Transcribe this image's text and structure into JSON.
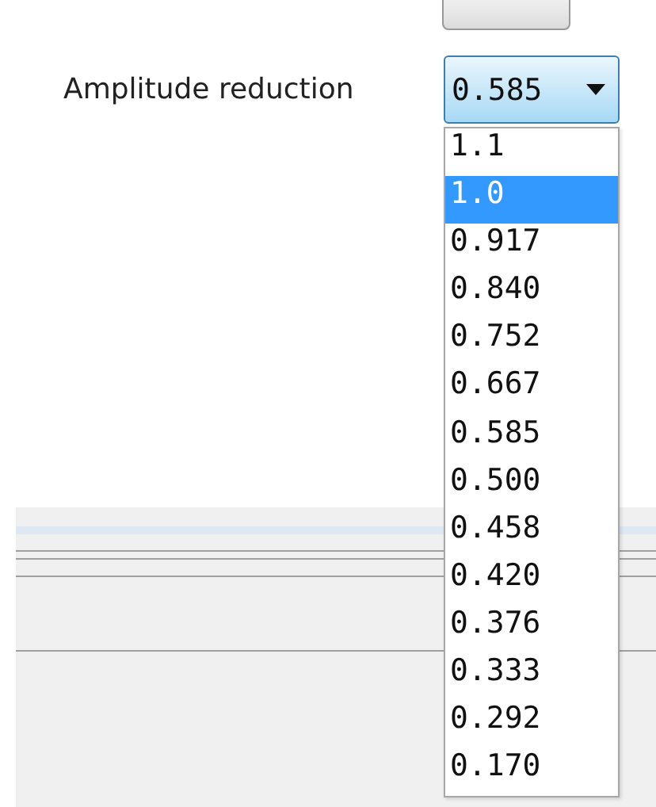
{
  "label": "Amplitude reduction",
  "select": {
    "value": "0.585",
    "expanded": true
  },
  "options": [
    {
      "label": "1.1",
      "selected": false
    },
    {
      "label": "1.0",
      "selected": true
    },
    {
      "label": "0.917",
      "selected": false
    },
    {
      "label": "0.840",
      "selected": false
    },
    {
      "label": "0.752",
      "selected": false
    },
    {
      "label": "0.667",
      "selected": false
    },
    {
      "label": "0.585",
      "selected": false
    },
    {
      "label": "0.500",
      "selected": false
    },
    {
      "label": "0.458",
      "selected": false
    },
    {
      "label": "0.420",
      "selected": false
    },
    {
      "label": "0.376",
      "selected": false
    },
    {
      "label": "0.333",
      "selected": false
    },
    {
      "label": "0.292",
      "selected": false
    },
    {
      "label": "0.170",
      "selected": false
    }
  ]
}
